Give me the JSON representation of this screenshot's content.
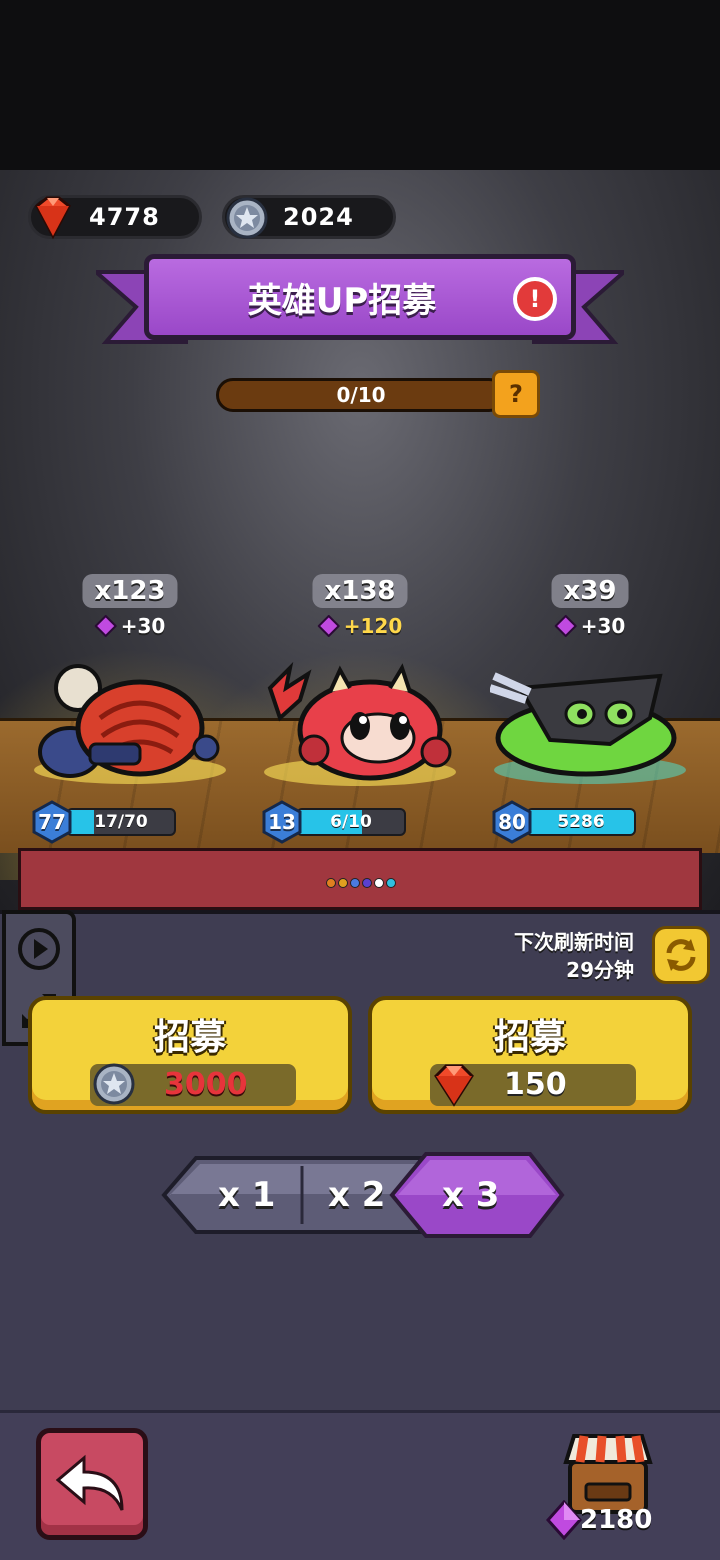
{
  "currencies": {
    "gems": {
      "value": "4778",
      "icon": "red-gem-icon"
    },
    "coins": {
      "value": "2024",
      "icon": "silver-star-coin-icon"
    }
  },
  "banner": {
    "title": "英雄UP招募",
    "alert_icon": "exclamation-icon",
    "alert_glyph": "!"
  },
  "progress": {
    "text": "0/10",
    "value": 0,
    "max": 10,
    "help_glyph": "?"
  },
  "heroes": [
    {
      "count": "x123",
      "bonus": "+30",
      "level": "77",
      "progress_text": "17/70",
      "progress_fraction": 0.243,
      "name_icon": "red-shell-bomb-hero-icon"
    },
    {
      "count": "x138",
      "bonus": "+120",
      "level": "13",
      "progress_text": "6/10",
      "progress_fraction": 0.6,
      "name_icon": "red-dragon-hero-icon"
    },
    {
      "count": "x39",
      "bonus": "+30",
      "level": "80",
      "progress_text": "5286",
      "progress_fraction": 1.0,
      "name_icon": "green-ninja-blob-hero-icon"
    }
  ],
  "page_dots": [
    "#e08020",
    "#e0a020",
    "#4a7ae0",
    "#5a40d0",
    "#ffffff",
    "#30c0e0"
  ],
  "refresh": {
    "label": "下次刷新时间",
    "time": "29分钟"
  },
  "recruit_buttons": [
    {
      "label": "招募",
      "price": "3000",
      "currency_icon": "silver-star-coin-icon",
      "price_color": "#e7343b"
    },
    {
      "label": "招募",
      "price": "150",
      "currency_icon": "red-gem-icon",
      "price_color": "#ffffff"
    }
  ],
  "multiplier": {
    "options": [
      "x 1",
      "x 2",
      "x 3"
    ],
    "selected": "x 3"
  },
  "bottom": {
    "purple_gems": "2180"
  },
  "colors": {
    "accent_purple": "#9a48c8",
    "button_yellow": "#f3d23a",
    "back_red": "#c84a62",
    "panel_bg": "#3f3d52"
  }
}
